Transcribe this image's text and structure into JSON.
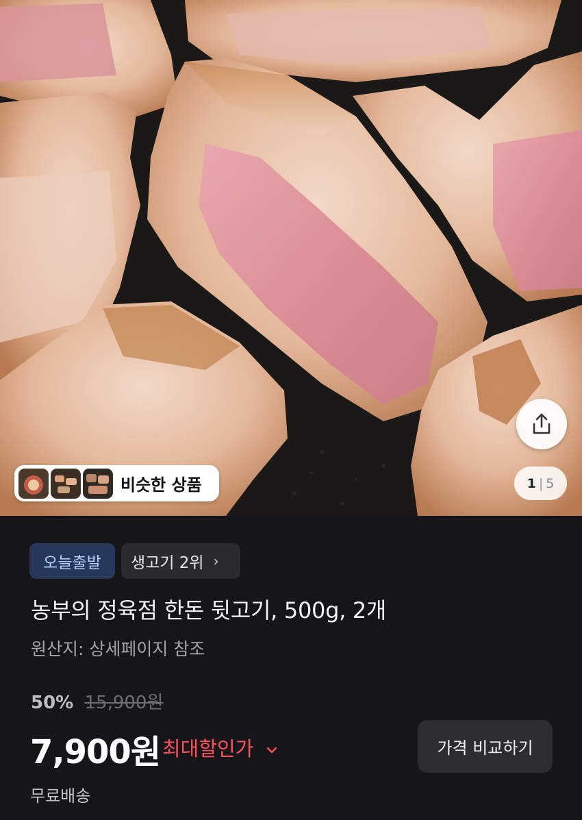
{
  "hero": {
    "similar_label": "비슷한 상품",
    "thumbnails": [
      "thumb-1",
      "thumb-2",
      "thumb-3"
    ],
    "image_index": "1",
    "image_separator": "|",
    "image_total": "5",
    "share_icon": "share-icon"
  },
  "badges": {
    "today_ship": "오늘출발",
    "rank": "생고기 2위",
    "rank_chevron": "›"
  },
  "product": {
    "title": "농부의 정육점 한돈 뒷고기, 500g, 2개",
    "origin": "원산지: 상세페이지 참조"
  },
  "pricing": {
    "discount_rate": "50%",
    "original_price": "15,900원",
    "price": "7,900원",
    "max_discount_label": "최대할인가",
    "max_discount_chevron": "⌄",
    "compare_button": "가격 비교하기",
    "shipping": "무료배송"
  },
  "colors": {
    "background": "#16161a",
    "accent_red": "#ff4d5a",
    "today_badge_bg": "#27385c",
    "today_badge_text": "#b8cdf5"
  }
}
